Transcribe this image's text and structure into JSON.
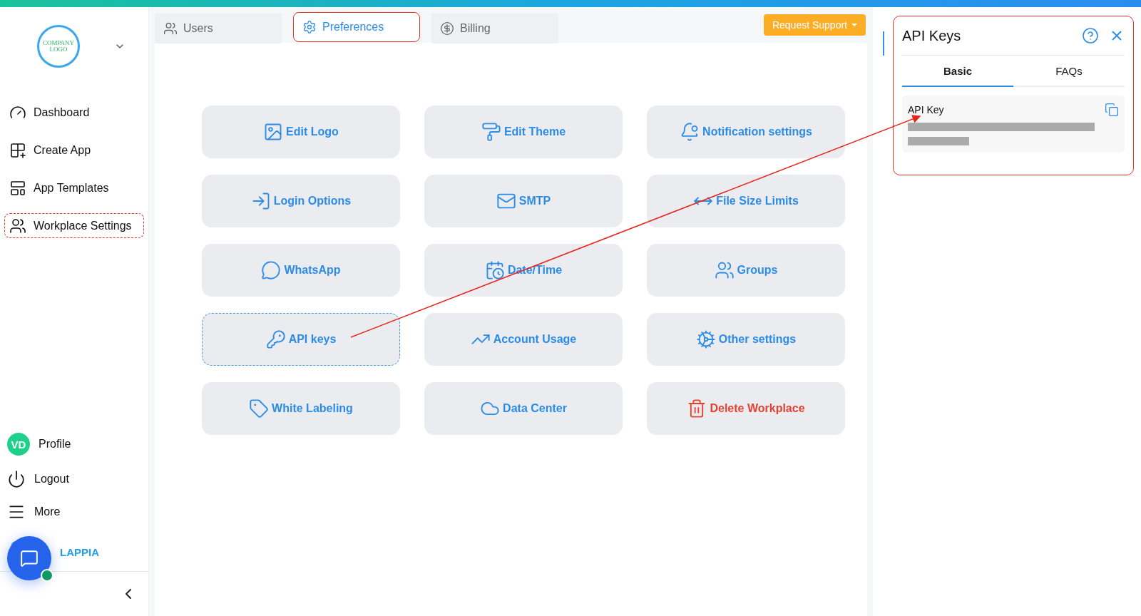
{
  "sidebar": {
    "logo_text": "COMPANY LOGO",
    "items": [
      {
        "label": "Dashboard",
        "selected": false
      },
      {
        "label": "Create App",
        "selected": false
      },
      {
        "label": "App Templates",
        "selected": false
      },
      {
        "label": "Workplace Settings",
        "selected": true
      }
    ],
    "profile": {
      "initials": "VD",
      "label": "Profile"
    },
    "bottom_items": [
      {
        "label": "Logout"
      },
      {
        "label": "More"
      }
    ],
    "brand": "LAPPIA"
  },
  "tabs": [
    {
      "label": "Users",
      "selected": false
    },
    {
      "label": "Preferences",
      "selected": true
    },
    {
      "label": "Billing",
      "selected": false
    }
  ],
  "support_button": "Request Support",
  "tiles": [
    {
      "label": "Edit Logo",
      "kind": "normal",
      "selected": false
    },
    {
      "label": "Edit Theme",
      "kind": "normal",
      "selected": false
    },
    {
      "label": "Notification settings",
      "kind": "normal",
      "selected": false
    },
    {
      "label": "Login Options",
      "kind": "normal",
      "selected": false
    },
    {
      "label": "SMTP",
      "kind": "normal",
      "selected": false
    },
    {
      "label": "File Size Limits",
      "kind": "normal",
      "selected": false
    },
    {
      "label": "WhatsApp",
      "kind": "normal",
      "selected": false
    },
    {
      "label": "Date/Time",
      "kind": "normal",
      "selected": false
    },
    {
      "label": "Groups",
      "kind": "normal",
      "selected": false
    },
    {
      "label": "API keys",
      "kind": "normal",
      "selected": true
    },
    {
      "label": "Account Usage",
      "kind": "normal",
      "selected": false
    },
    {
      "label": "Other settings",
      "kind": "normal",
      "selected": false
    },
    {
      "label": "White Labeling",
      "kind": "normal",
      "selected": false
    },
    {
      "label": "Data Center",
      "kind": "normal",
      "selected": false
    },
    {
      "label": "Delete Workplace",
      "kind": "danger",
      "selected": false
    }
  ],
  "panel": {
    "title": "API Keys",
    "tabs": [
      {
        "label": "Basic",
        "selected": true
      },
      {
        "label": "FAQs",
        "selected": false
      }
    ],
    "field_label": "API Key"
  }
}
